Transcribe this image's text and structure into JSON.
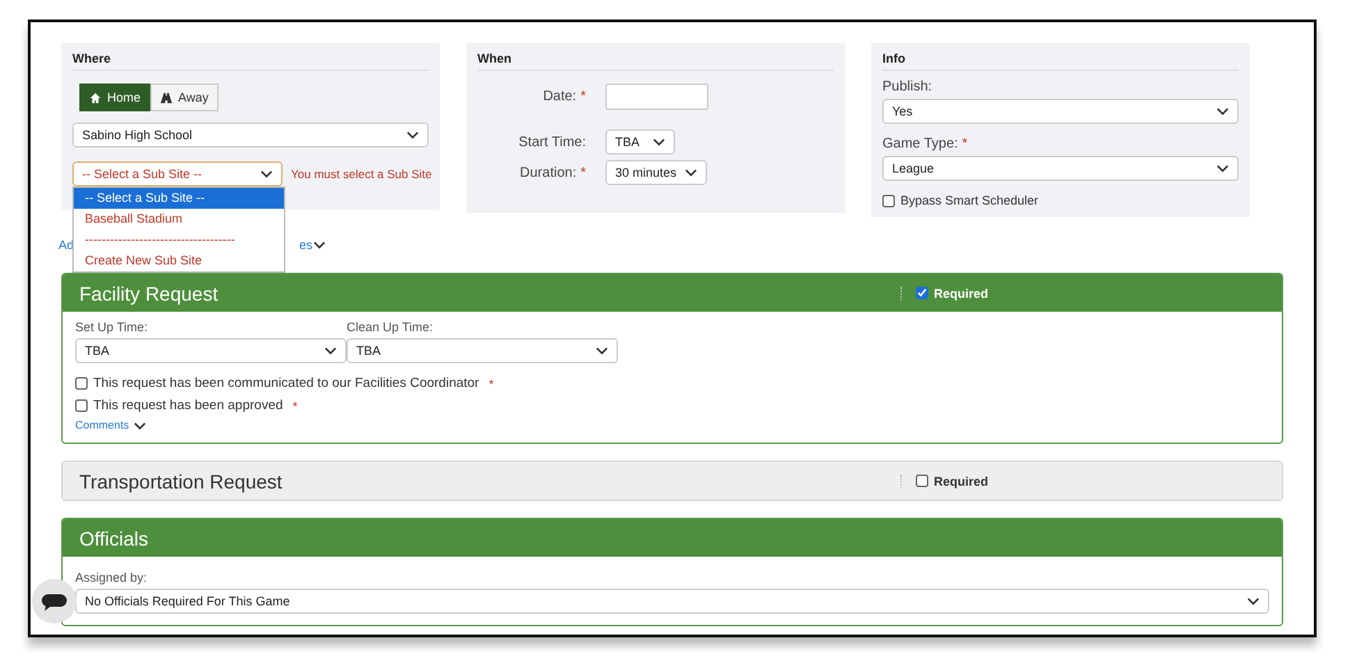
{
  "where": {
    "title": "Where",
    "toggle": [
      {
        "label": "Home",
        "selected": true
      },
      {
        "label": "Away",
        "selected": false
      }
    ],
    "school": "Sabino High School",
    "subsite": "-- Select a Sub Site --",
    "error": "You must select a Sub Site",
    "options": [
      {
        "label": "-- Select a Sub Site --",
        "selected": true
      },
      {
        "label": "Baseball Stadium",
        "selected": false
      },
      {
        "label": "------------------------------------",
        "selected": false
      },
      {
        "label": "Create New Sub Site",
        "selected": false
      }
    ],
    "link_start": "Ad",
    "link_end": "es"
  },
  "when": {
    "title": "When",
    "date_label": "Date:",
    "date_mark": "*",
    "start_label": "Start Time:",
    "start_value": "TBA",
    "duration_label": "Duration:",
    "duration_mark": "*",
    "duration_value": "30 minutes"
  },
  "info": {
    "title": "Info",
    "publish_label": "Publish:",
    "publish_value": "Yes",
    "type_label": "Game Type:",
    "type_mark": "*",
    "type_value": "League",
    "bypass_label": "Bypass Smart Scheduler",
    "bypass_checked": false
  },
  "sections": [
    {
      "title": "Facility Request",
      "active": true,
      "required_label": "Required",
      "required": true,
      "setup_label": "Set Up Time:",
      "setup_value": "TBA",
      "cleanup_label": "Clean Up Time:",
      "cleanup_value": "TBA",
      "checks": [
        {
          "label": "This request has been communicated to our Facilities Coordinator",
          "checked": false,
          "mark": "*"
        },
        {
          "label": "This request has been approved",
          "checked": false,
          "mark": "*"
        }
      ],
      "comments": "Comments"
    },
    {
      "title": "Transportation Request",
      "active": false,
      "required_label": "Required",
      "required": false
    },
    {
      "title": "Officials",
      "active": true,
      "assigned_label": "Assigned by:",
      "assigned_value": "No Officials Required For This Game"
    }
  ]
}
